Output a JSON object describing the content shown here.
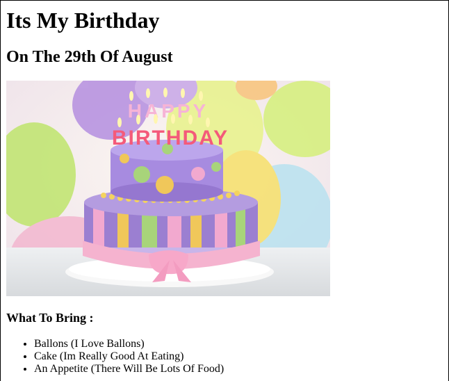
{
  "page": {
    "title": "Its My Birthday",
    "subtitle": "On The 29th Of August",
    "hero_image": {
      "alt": "Birthday cake with HAPPY BIRTHDAY candles",
      "candle_line1": "HAPPY",
      "candle_line2": "BIRTHDAY"
    },
    "bring_heading": "What To Bring :",
    "bring_items": [
      "Ballons (I Love Ballons)",
      "Cake (Im Really Good At Eating)",
      "An Appetite (There Will Be Lots Of Food)"
    ]
  },
  "colors": {
    "text": "#000000",
    "background": "#ffffff",
    "cake_purple": "#9b7fd1",
    "cake_pink": "#f2a9cf",
    "cake_yellow": "#f0c75a",
    "cake_green": "#a8d47a"
  }
}
